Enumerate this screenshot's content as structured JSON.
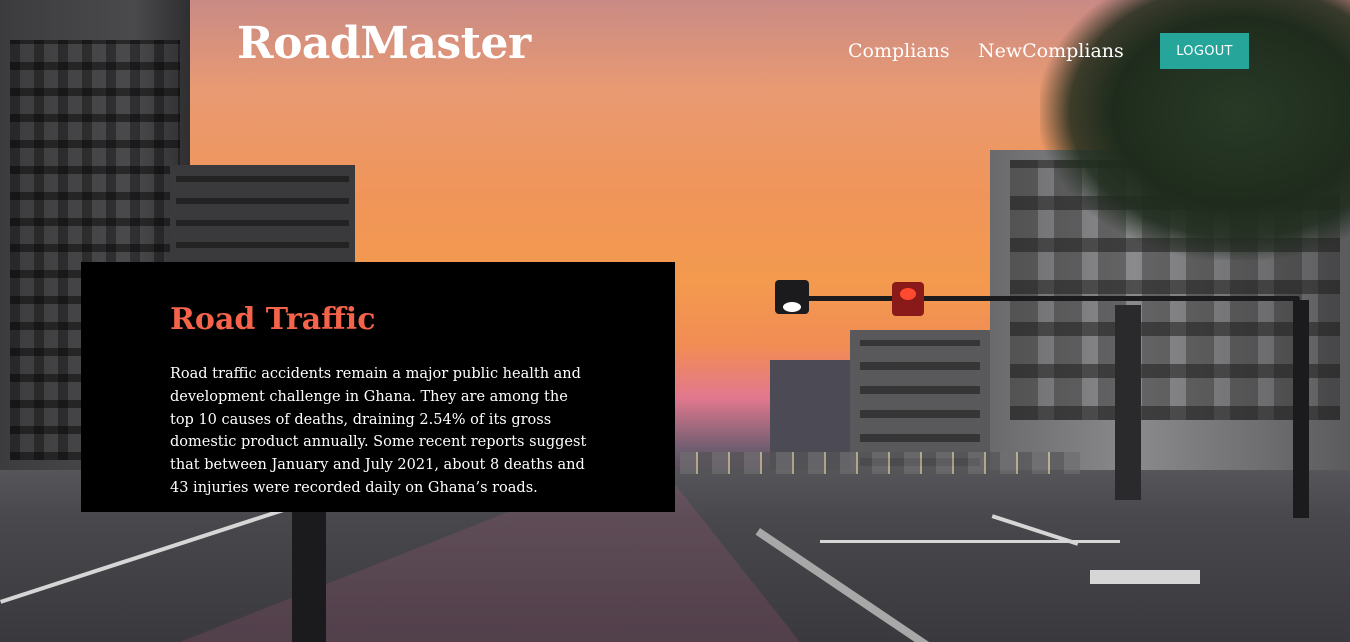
{
  "navbar": {
    "brand": "RoadMaster",
    "links": [
      {
        "label": "Complians"
      },
      {
        "label": "NewComplians"
      }
    ],
    "logout_label": "LOGOUT"
  },
  "hero": {
    "background": "sunset city street with traffic lights",
    "card": {
      "title": "Road Traffic",
      "text": "Road traffic accidents remain a major public health and development challenge in Ghana. They are among the top 10 causes of deaths, draining 2.54% of its gross domestic product annually. Some recent reports suggest that between January and July 2021, about 8 deaths and 43 injuries were recorded daily on Ghana’s roads."
    }
  },
  "colors": {
    "accent_button": "#26a69a",
    "title_color": "#f4634a",
    "card_background": "#000000"
  }
}
